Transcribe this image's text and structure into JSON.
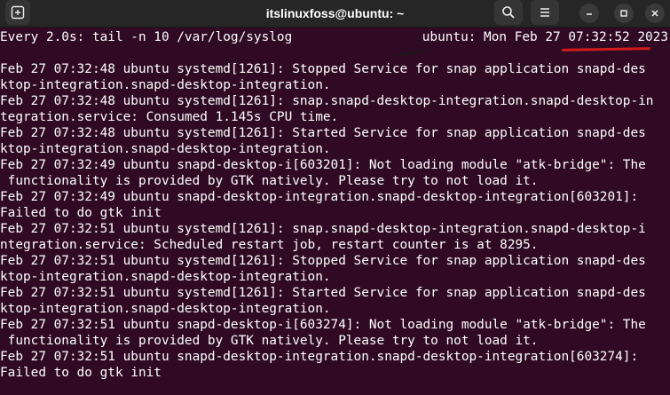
{
  "window": {
    "title": "itslinuxfoss@ubuntu: ~",
    "icons": {
      "new_tab": "new-tab-icon",
      "search": "search-icon",
      "menu": "hamburger-menu-icon",
      "minimize": "minimize-icon",
      "maximize": "maximize-icon",
      "close": "close-icon"
    }
  },
  "colors": {
    "terminal_bg": "#300a24",
    "text": "#ffffff",
    "titlebar_bg": "#262626",
    "highlight_underline": "#d11a1a"
  },
  "terminal": {
    "header_left": "Every 2.0s: tail -n 10 /var/log/syslog",
    "header_right": "ubuntu: Mon Feb 27 07:32:52 2023",
    "lines": [
      "Feb 27 07:32:48 ubuntu systemd[1261]: Stopped Service for snap application snapd-des",
      "ktop-integration.snapd-desktop-integration.",
      "Feb 27 07:32:48 ubuntu systemd[1261]: snap.snapd-desktop-integration.snapd-desktop-in",
      "tegration.service: Consumed 1.145s CPU time.",
      "Feb 27 07:32:48 ubuntu systemd[1261]: Started Service for snap application snapd-des",
      "ktop-integration.snapd-desktop-integration.",
      "Feb 27 07:32:49 ubuntu snapd-desktop-i[603201]: Not loading module \"atk-bridge\": The",
      " functionality is provided by GTK natively. Please try to not load it.",
      "Feb 27 07:32:49 ubuntu snapd-desktop-integration.snapd-desktop-integration[603201]:",
      "Failed to do gtk init",
      "Feb 27 07:32:51 ubuntu systemd[1261]: snap.snapd-desktop-integration.snapd-desktop-i",
      "ntegration.service: Scheduled restart job, restart counter is at 8295.",
      "Feb 27 07:32:51 ubuntu systemd[1261]: Stopped Service for snap application snapd-des",
      "ktop-integration.snapd-desktop-integration.",
      "Feb 27 07:32:51 ubuntu systemd[1261]: Started Service for snap application snapd-des",
      "ktop-integration.snapd-desktop-integration.",
      "Feb 27 07:32:51 ubuntu snapd-desktop-i[603274]: Not loading module \"atk-bridge\": The",
      " functionality is provided by GTK natively. Please try to not load it.",
      "Feb 27 07:32:51 ubuntu snapd-desktop-integration.snapd-desktop-integration[603274]:",
      "Failed to do gtk init"
    ]
  }
}
